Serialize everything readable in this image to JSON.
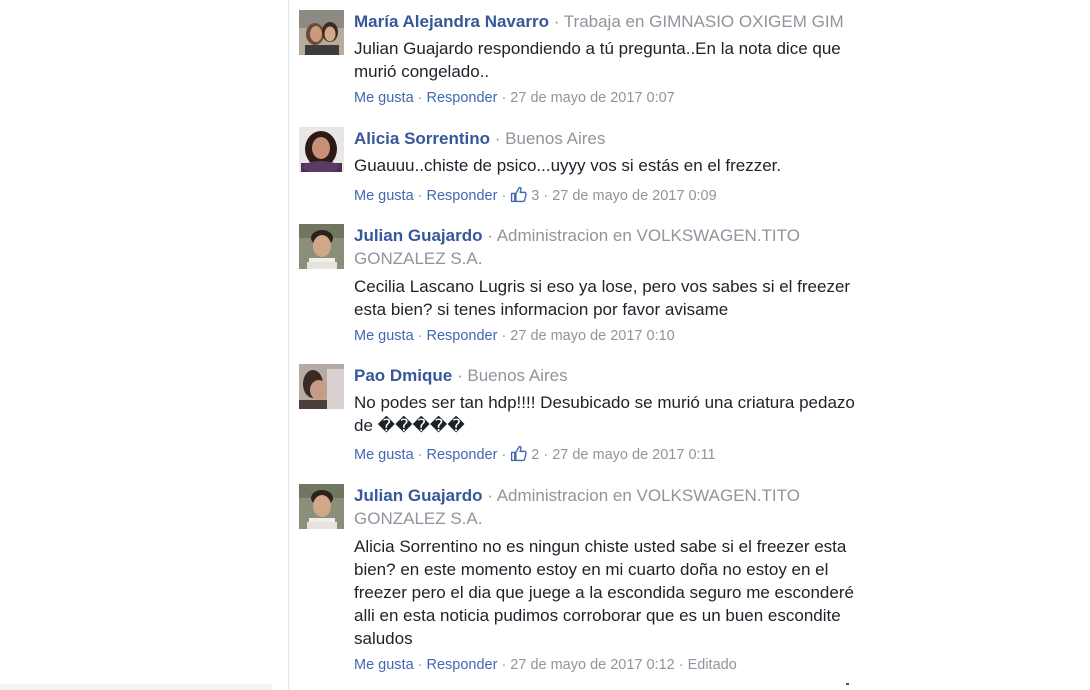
{
  "comments": [
    {
      "author": "María Alejandra Navarro",
      "meta": "Trabaja en GIMNASIO OXIGEM GIM",
      "text_lines": [
        "Julian Guajardo respondiendo a tú pregunta..En la nota dice que",
        "murió congelado.."
      ],
      "like_label": "Me gusta",
      "reply_label": "Responder",
      "likes": "",
      "time": "27 de mayo de 2017 0:07",
      "edited": ""
    },
    {
      "author": "Alicia Sorrentino",
      "meta": "Buenos Aires",
      "text_lines": [
        "Guauuu..chiste de psico...uyyy vos si estás en el frezzer."
      ],
      "like_label": "Me gusta",
      "reply_label": "Responder",
      "likes": "3",
      "time": "27 de mayo de 2017 0:09",
      "edited": ""
    },
    {
      "author": "Julian Guajardo",
      "meta_lines": [
        "Administracion en VOLKSWAGEN.TITO",
        "GONZALEZ S.A."
      ],
      "text_lines": [
        "Cecilia Lascano Lugris si eso ya lose, pero vos sabes si el freezer",
        "esta bien? si tenes informacion por favor avisame"
      ],
      "like_label": "Me gusta",
      "reply_label": "Responder",
      "likes": "",
      "time": "27 de mayo de 2017 0:10",
      "edited": ""
    },
    {
      "author": "Pao Dmique",
      "meta": "Buenos Aires",
      "text_lines": [
        "No podes ser tan hdp!!!! Desubicado se murió una criatura pedazo",
        "de �����"
      ],
      "like_label": "Me gusta",
      "reply_label": "Responder",
      "likes": "2",
      "time": "27 de mayo de 2017 0:11",
      "edited": ""
    },
    {
      "author": "Julian Guajardo",
      "meta_lines": [
        "Administracion en VOLKSWAGEN.TITO",
        "GONZALEZ S.A."
      ],
      "text_lines": [
        "Alicia Sorrentino no es ningun chiste usted sabe si el freezer esta",
        "bien? en este momento estoy en mi cuarto doña no estoy en el",
        "freezer pero el dia que juege a la escondida seguro me esconderé",
        "alli en esta noticia pudimos corroborar que es un buen escondite",
        "saludos"
      ],
      "like_label": "Me gusta",
      "reply_label": "Responder",
      "likes": "",
      "time": "27 de mayo de 2017 0:12",
      "edited": "Editado"
    }
  ],
  "separator": "·",
  "icons": {
    "like": "thumbs-up-icon"
  },
  "colors": {
    "author": "#365899",
    "link": "#4267b2",
    "meta": "#90949c",
    "text": "#1d2129"
  }
}
